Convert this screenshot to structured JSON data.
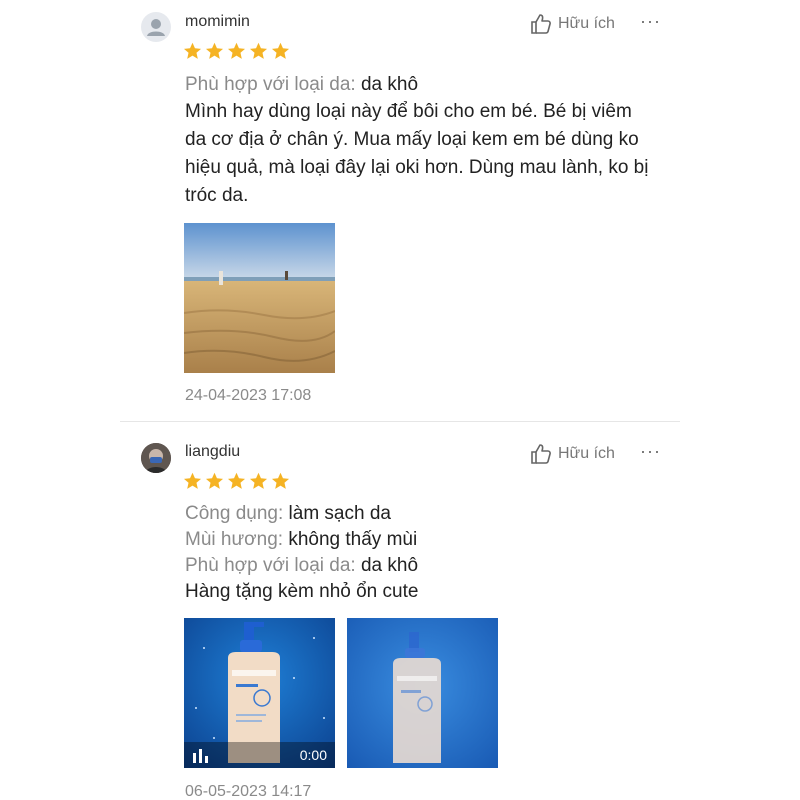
{
  "reviews": [
    {
      "username": "momimin",
      "helpful_label": "Hữu ích",
      "more_label": "···",
      "rating": 5,
      "attributes": [
        {
          "label": "Phù hợp với loại da:",
          "value": "da khô"
        }
      ],
      "text": "Mình hay dùng loại này để bôi cho em bé. Bé bị viêm da cơ địa ở chân ý. Mua mấy loại kem em bé dùng ko hiệu quả, mà loại đây lại oki hơn. Dùng mau lành, ko bị tróc da.",
      "timestamp": "24-04-2023 17:08"
    },
    {
      "username": "liangdiu",
      "helpful_label": "Hữu ích",
      "more_label": "···",
      "rating": 5,
      "attributes": [
        {
          "label": "Công dụng:",
          "value": "làm sạch da"
        },
        {
          "label": "Mùi hương:",
          "value": "không thấy mùi"
        },
        {
          "label": "Phù hợp với loại da:",
          "value": "da khô"
        }
      ],
      "text": "Hàng tặng kèm nhỏ ổn cute",
      "video_duration": "0:00",
      "timestamp": "06-05-2023 14:17"
    }
  ],
  "colors": {
    "star": "#f5b324",
    "label": "#8a8a8a",
    "text": "#222222"
  }
}
